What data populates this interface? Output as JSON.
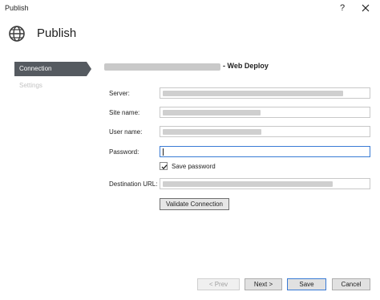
{
  "window": {
    "title": "Publish",
    "help_glyph": "?"
  },
  "header": {
    "title": "Publish",
    "icon": "globe-icon"
  },
  "nav": {
    "items": [
      {
        "label": "Connection",
        "state": "active"
      },
      {
        "label": "Settings",
        "state": "disabled"
      }
    ]
  },
  "section": {
    "title_suffix": "- Web Deploy"
  },
  "form": {
    "server_label": "Server:",
    "site_name_label": "Site name:",
    "user_name_label": "User name:",
    "password_label": "Password:",
    "save_password_label": "Save password",
    "save_password_checked": true,
    "destination_url_label": "Destination URL:",
    "validate_label": "Validate Connection"
  },
  "footer": {
    "prev_label": "< Prev",
    "next_label": "Next >",
    "save_label": "Save",
    "cancel_label": "Cancel"
  },
  "colors": {
    "nav_active_bg": "#555a60",
    "focus_border": "#3a7bd5"
  }
}
